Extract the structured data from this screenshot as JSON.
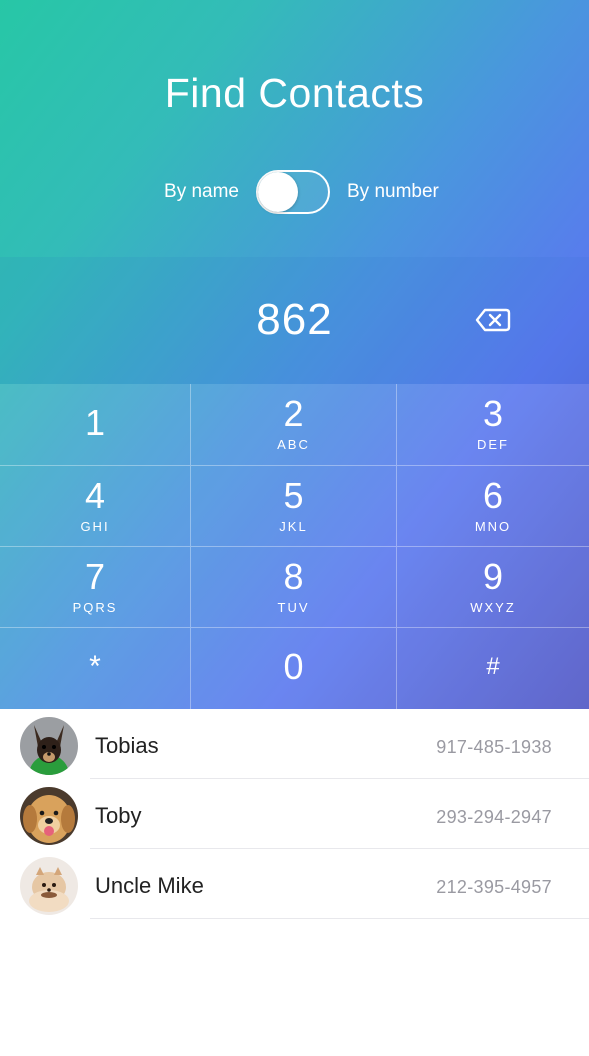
{
  "header": {
    "title": "Find Contacts",
    "toggle": {
      "left_label": "By name",
      "right_label": "By number",
      "state": "off"
    }
  },
  "display": {
    "number": "862",
    "backspace_icon": "backspace-icon"
  },
  "keypad": {
    "keys": [
      {
        "digit": "1",
        "letters": ""
      },
      {
        "digit": "2",
        "letters": "ABC"
      },
      {
        "digit": "3",
        "letters": "DEF"
      },
      {
        "digit": "4",
        "letters": "GHI"
      },
      {
        "digit": "5",
        "letters": "JKL"
      },
      {
        "digit": "6",
        "letters": "MNO"
      },
      {
        "digit": "7",
        "letters": "PQRS"
      },
      {
        "digit": "8",
        "letters": "TUV"
      },
      {
        "digit": "9",
        "letters": "WXYZ"
      },
      {
        "digit": "*",
        "letters": ""
      },
      {
        "digit": "0",
        "letters": ""
      },
      {
        "digit": "#",
        "letters": ""
      }
    ]
  },
  "contacts": [
    {
      "name": "Tobias",
      "phone": "917-485-1938",
      "avatar": "chihuahua-avatar"
    },
    {
      "name": "Toby",
      "phone": "293-294-2947",
      "avatar": "golden-retriever-avatar"
    },
    {
      "name": "Uncle Mike",
      "phone": "212-395-4957",
      "avatar": "pomeranian-avatar"
    }
  ],
  "colors": {
    "gradient_start": "#27c7a6",
    "gradient_mid": "#4a96de",
    "gradient_end": "#4f55c4",
    "text_primary": "#222222",
    "text_secondary": "#9a9aa2"
  }
}
